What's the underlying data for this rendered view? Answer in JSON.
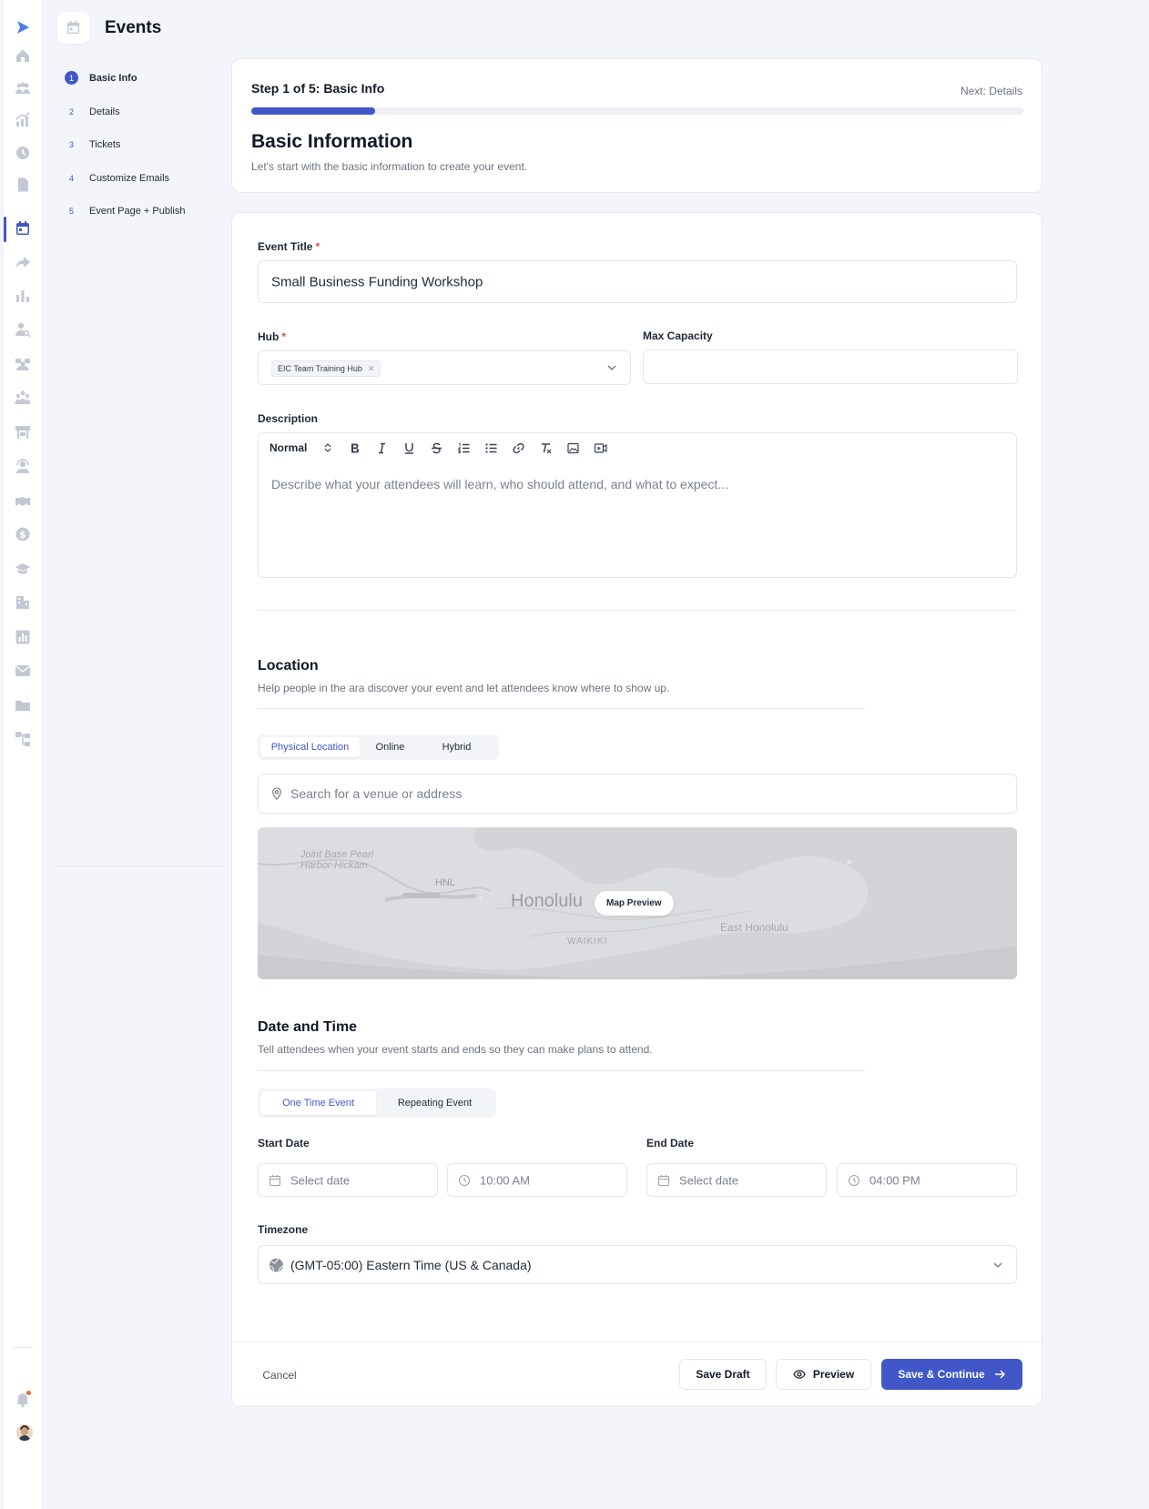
{
  "header": {
    "title": "Events"
  },
  "steps": [
    {
      "num": "1",
      "label": "Basic Info",
      "active": true
    },
    {
      "num": "2",
      "label": "Details",
      "active": false
    },
    {
      "num": "3",
      "label": "Tickets",
      "active": false
    },
    {
      "num": "4",
      "label": "Customize Emails",
      "active": false
    },
    {
      "num": "5",
      "label": "Event Page + Publish",
      "active": false
    }
  ],
  "progress": {
    "step_text": "Step 1 of 5: Basic Info",
    "next_text": "Next: Details",
    "fraction": 0.16
  },
  "intro": {
    "title": "Basic Information",
    "subtitle": "Let's start with the basic information to create your event."
  },
  "form": {
    "event_title_label": "Event Title",
    "event_title_value": "Small Business Funding Workshop",
    "hub_label": "Hub",
    "hub_chip": "EIC Team Training Hub",
    "max_capacity_label": "Max Capacity",
    "max_capacity_value": "",
    "description_label": "Description",
    "editor_format": "Normal",
    "description_placeholder": "Describe what your attendees will learn, who should attend, and what to expect..."
  },
  "location": {
    "title": "Location",
    "subtitle": "Help people in the ara discover your event and let attendees know where to show up.",
    "tabs": [
      "Physical Location",
      "Online",
      "Hybrid"
    ],
    "active_tab": "Physical Location",
    "search_placeholder": "Search for a venue or address",
    "map_button": "Map Preview",
    "map_labels": {
      "base": "Joint Base Pearl Harbor-Hickam",
      "airport": "HNL",
      "city": "Honolulu",
      "east": "East Honolulu",
      "district": "WAIKIKI"
    }
  },
  "datetime": {
    "title": "Date and Time",
    "subtitle": "Tell attendees when your event starts and ends so they can make plans to attend.",
    "tabs": [
      "One Time Event",
      "Repeating Event"
    ],
    "active_tab": "One Time Event",
    "start_label": "Start Date",
    "end_label": "End Date",
    "start_date_placeholder": "Select date",
    "start_time": "10:00 AM",
    "end_date_placeholder": "Select date",
    "end_time": "04:00 PM",
    "timezone_label": "Timezone",
    "timezone_value": "(GMT-05:00) Eastern Time (US & Canada)"
  },
  "footer": {
    "cancel": "Cancel",
    "save_draft": "Save Draft",
    "preview": "Preview",
    "save_continue": "Save & Continue"
  },
  "colors": {
    "accent": "#4157c8",
    "required": "#e5484d",
    "notification": "#f26b3a"
  },
  "rail_icons": [
    "logo-icon",
    "home-icon",
    "people-icon",
    "growth-chart-icon",
    "clock-icon",
    "document-icon",
    "calendar-icon",
    "share-arrow-icon",
    "bar-chart-icon",
    "user-search-icon",
    "group-icon",
    "team-icon",
    "kiosk-icon",
    "support-agent-icon",
    "handshake-icon",
    "dollar-icon",
    "graduation-cap-icon",
    "building-icon",
    "analytics-icon",
    "mail-icon",
    "folder-icon",
    "workflow-icon",
    "bell-icon",
    "avatar"
  ]
}
